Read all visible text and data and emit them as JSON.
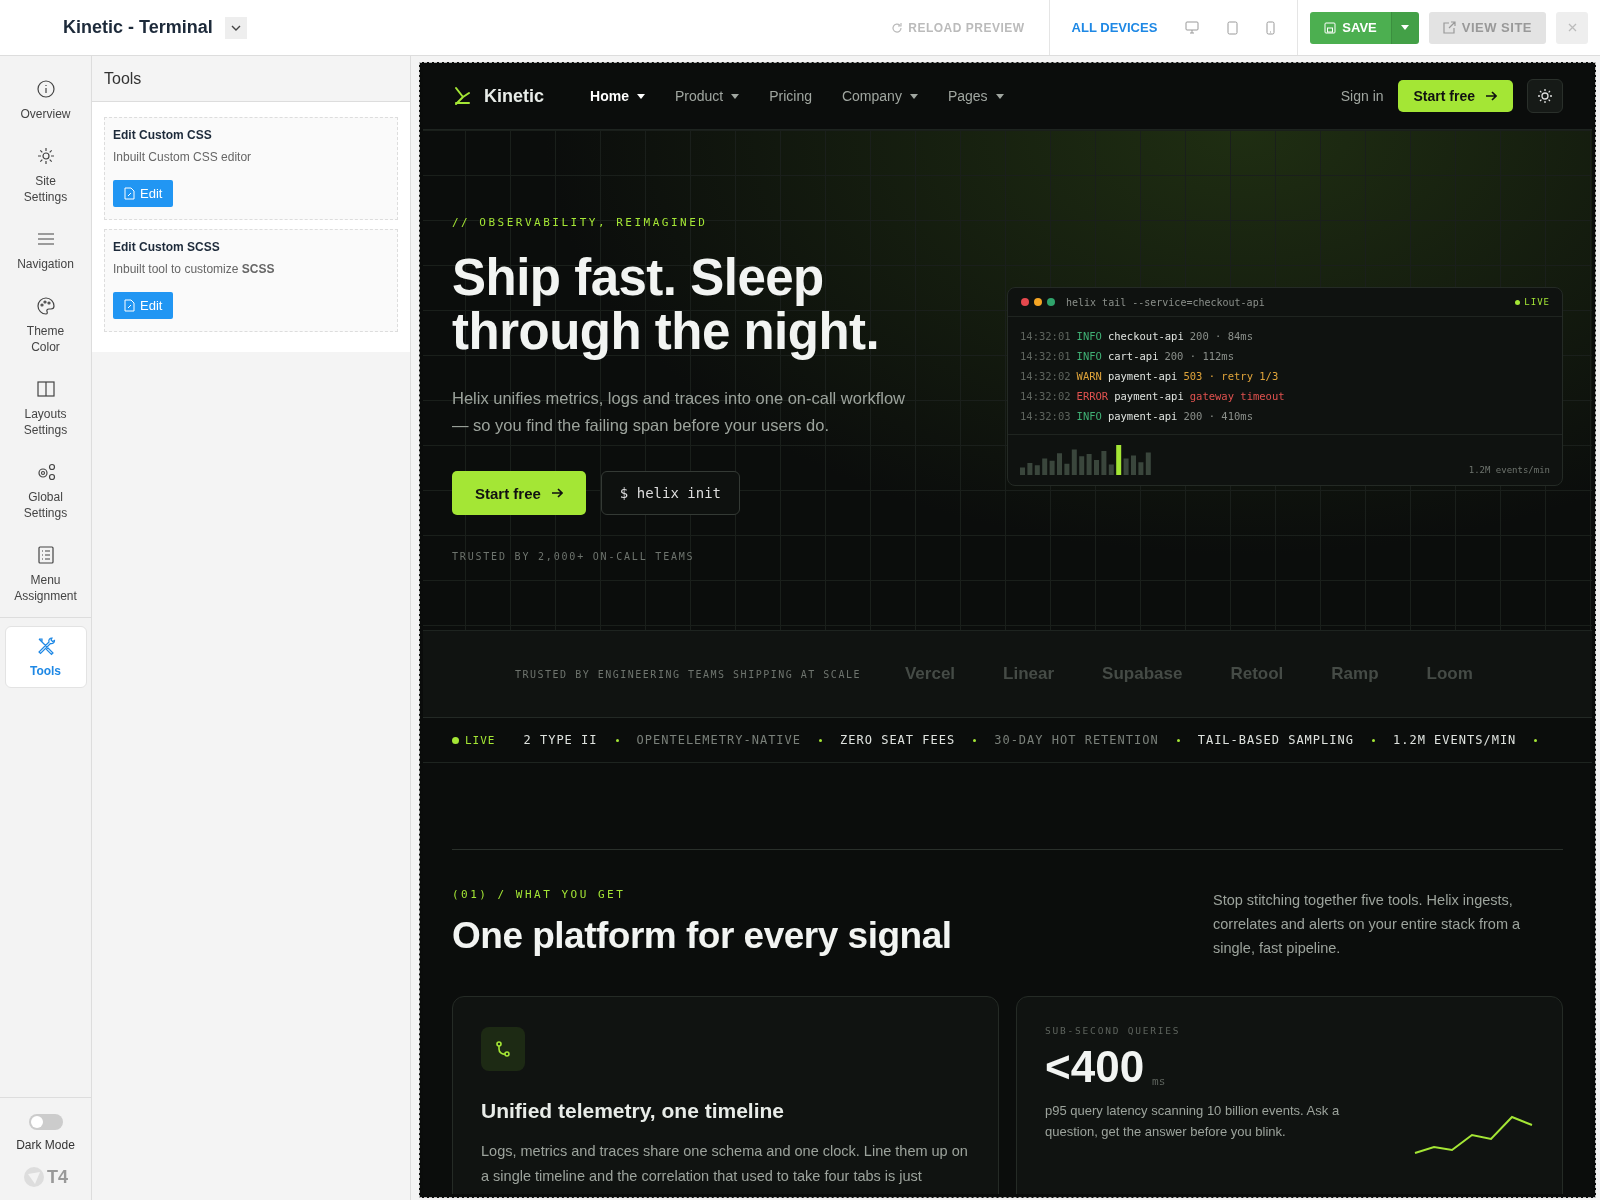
{
  "topbar": {
    "title": "Kinetic - Terminal",
    "reload": "RELOAD PREVIEW",
    "devices": [
      {
        "kind": "all",
        "label": "ALL DEVICES",
        "selected": true
      },
      {
        "kind": "desktop",
        "selected": false
      },
      {
        "kind": "tablet",
        "selected": false
      },
      {
        "kind": "phone",
        "selected": false
      }
    ],
    "save": "SAVE",
    "view_site": "VIEW SITE"
  },
  "sidebar": {
    "items": [
      {
        "label": "Overview",
        "selected": false
      },
      {
        "label": "Site Settings",
        "selected": false
      },
      {
        "label": "Navigation",
        "selected": false
      },
      {
        "label": "Theme Color",
        "selected": false
      },
      {
        "label": "Layouts Settings",
        "selected": false
      },
      {
        "label": "Global Settings",
        "selected": false
      },
      {
        "label": "Menu Assignment",
        "selected": false
      },
      {
        "label": "Tools",
        "selected": true
      }
    ],
    "dark_mode": {
      "label": "Dark Mode",
      "on": false
    },
    "logo": "T4"
  },
  "tools_panel": {
    "title": "Tools",
    "cards": [
      {
        "title": "Edit Custom CSS",
        "text": "Inbuilt Custom CSS editor",
        "button": "Edit"
      },
      {
        "title": "Edit Custom SCSS",
        "text": "Inbuilt tool to customize **SCSS**",
        "button": "Edit"
      }
    ]
  },
  "site": {
    "brand": "Kinetic",
    "nav": [
      {
        "label": "Home",
        "dropdown": true,
        "selected": true
      },
      {
        "label": "Product",
        "dropdown": true,
        "selected": false
      },
      {
        "label": "Pricing",
        "dropdown": false,
        "selected": false
      },
      {
        "label": "Company",
        "dropdown": true,
        "selected": false
      },
      {
        "label": "Pages",
        "dropdown": true,
        "selected": false
      }
    ],
    "sign_in": "Sign in",
    "cta": "Start free",
    "hero": {
      "eyebrow": "// OBSERVABILITY, REIMAGINED",
      "headline": "Ship fast. Sleep through the night.",
      "text": "Helix unifies metrics, logs and traces into one on-call workflow — so you find the failing span before your users do.",
      "primary": "Start free",
      "secondary": "$ helix init",
      "trusted": "TRUSTED BY 2,000+ ON-CALL TEAMS"
    },
    "terminal": {
      "command": "helix tail --service=checkout-api",
      "live": "LIVE",
      "lines": [
        {
          "time": "14:32:01",
          "kind": "info",
          "level": "INFO",
          "service": "checkout-api",
          "detail": "200 · 84ms"
        },
        {
          "time": "14:32:01",
          "kind": "info",
          "level": "INFO",
          "service": "cart-api",
          "detail": "200 · 112ms"
        },
        {
          "time": "14:32:02",
          "kind": "warn",
          "level": "WARN",
          "service": "payment-api",
          "detail": "503 · retry 1/3"
        },
        {
          "time": "14:32:02",
          "kind": "error",
          "level": "ERROR",
          "service": "payment-api",
          "detail": "gateway timeout"
        },
        {
          "time": "14:32:03",
          "kind": "info",
          "level": "INFO",
          "service": "payment-api",
          "detail": "200 · 410ms"
        }
      ],
      "rate": "1.2M events/min"
    },
    "logos": {
      "label": "TRUSTED BY ENGINEERING TEAMS SHIPPING AT SCALE",
      "names": [
        "Vercel",
        "Linear",
        "Supabase",
        "Retool",
        "Ramp",
        "Loom"
      ]
    },
    "ticker": {
      "live": "LIVE",
      "items": [
        {
          "text": "2 TYPE II",
          "bright": true
        },
        {
          "text": "OPENTELEMETRY-NATIVE",
          "bright": false
        },
        {
          "text": "ZERO SEAT FEES",
          "bright": true
        },
        {
          "text": "30-DAY HOT RETENTION",
          "bright": false
        },
        {
          "text": "TAIL-BASED SAMPLING",
          "bright": true
        },
        {
          "text": "1.2M EVENTS/MIN",
          "bright": true
        }
      ]
    },
    "features": {
      "eyebrow": "(01) / WHAT YOU GET",
      "heading": "One platform for every signal",
      "intro": "Stop stitching together five tools. Helix ingests, correlates and alerts on your entire stack from a single, fast pipeline.",
      "card": {
        "title": "Unified telemetry, one timeline",
        "text": "Logs, metrics and traces share one schema and one clock. Line them up on a single timeline and the correlation that used to take four tabs is just"
      },
      "stat": {
        "eyebrow": "SUB-SECOND QUERIES",
        "value": "<400",
        "unit": "ms",
        "text": "p95 query latency scanning 10 billion events. Ask a question, get the answer before you blink."
      }
    }
  }
}
